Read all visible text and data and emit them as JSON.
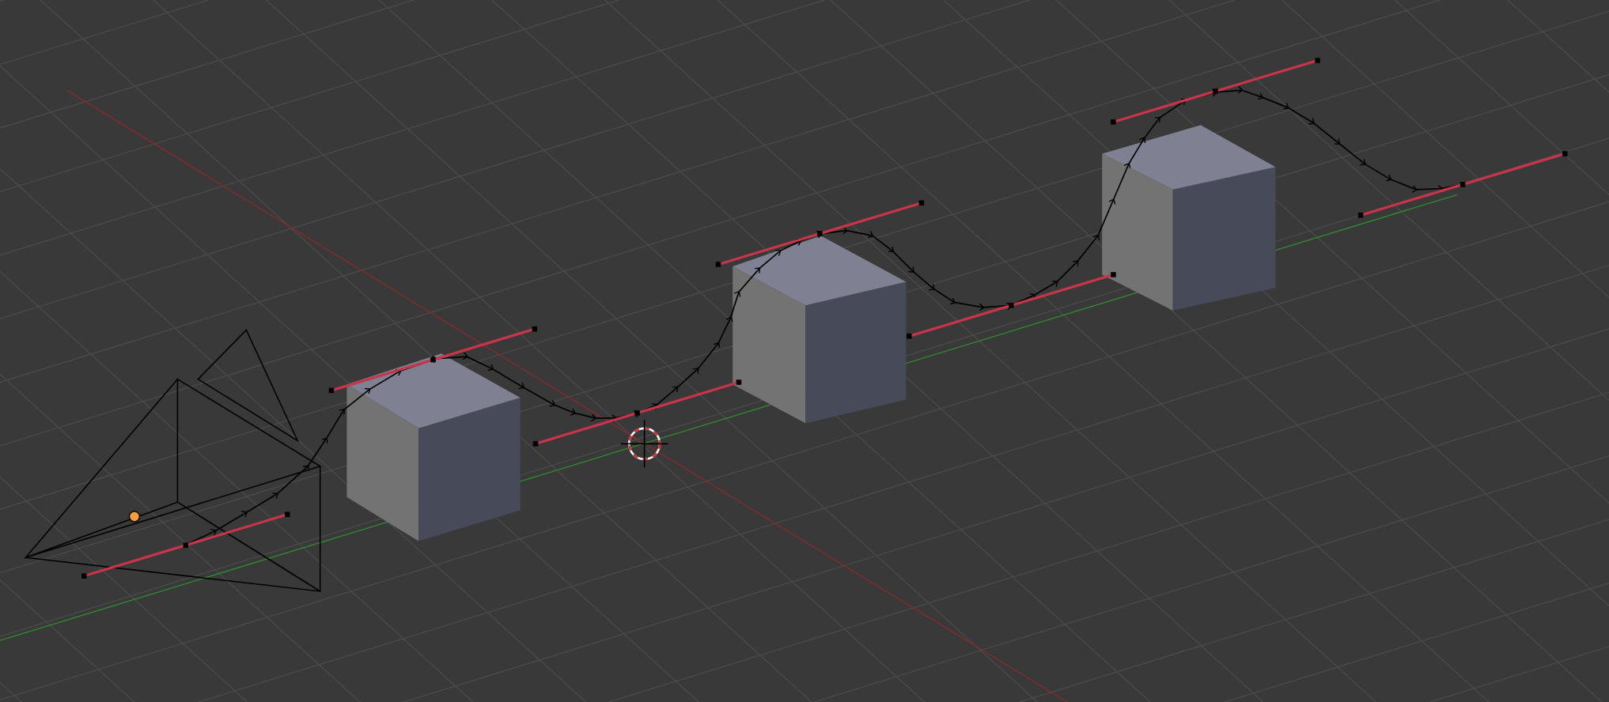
{
  "viewport": {
    "objects": [
      {
        "kind": "grid"
      },
      {
        "kind": "camera"
      },
      {
        "kind": "cube"
      },
      {
        "kind": "cube"
      },
      {
        "kind": "cube"
      },
      {
        "kind": "curve"
      },
      {
        "kind": "cursor"
      }
    ]
  }
}
